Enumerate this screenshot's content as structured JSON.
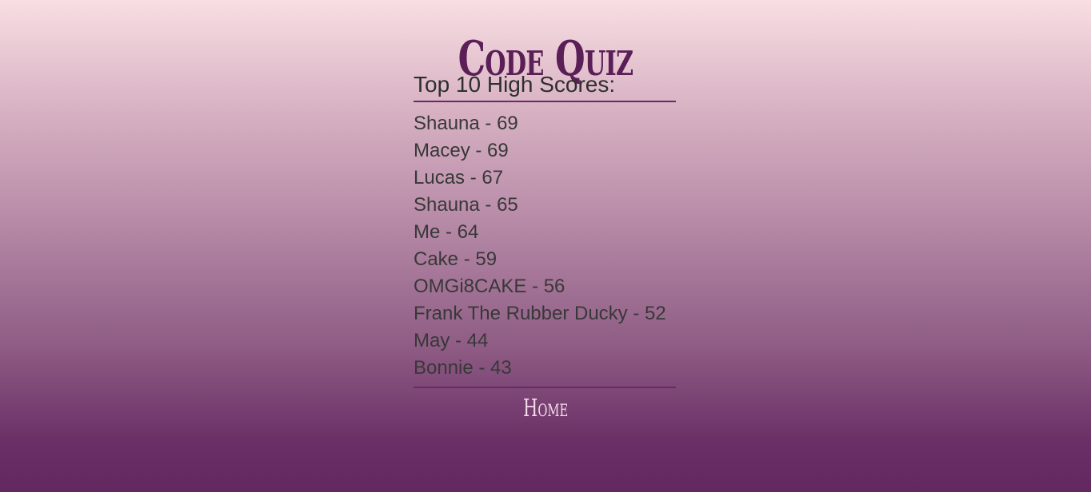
{
  "app": {
    "title": "Code Quiz"
  },
  "scoreboard": {
    "heading": "Top 10 High Scores:",
    "entries": [
      "Shauna - 69",
      "Macey - 69",
      "Lucas - 67",
      "Shauna - 65",
      "Me - 64",
      "Cake - 59",
      "OMGi8CAKE - 56",
      "Frank The Rubber Ducky - 52",
      "May - 44",
      "Bonnie - 43"
    ]
  },
  "nav": {
    "home_label": "Home"
  },
  "colors": {
    "accent": "#5a1f57",
    "gradient_top": "#f8dfe3",
    "gradient_bottom": "#62285f"
  }
}
